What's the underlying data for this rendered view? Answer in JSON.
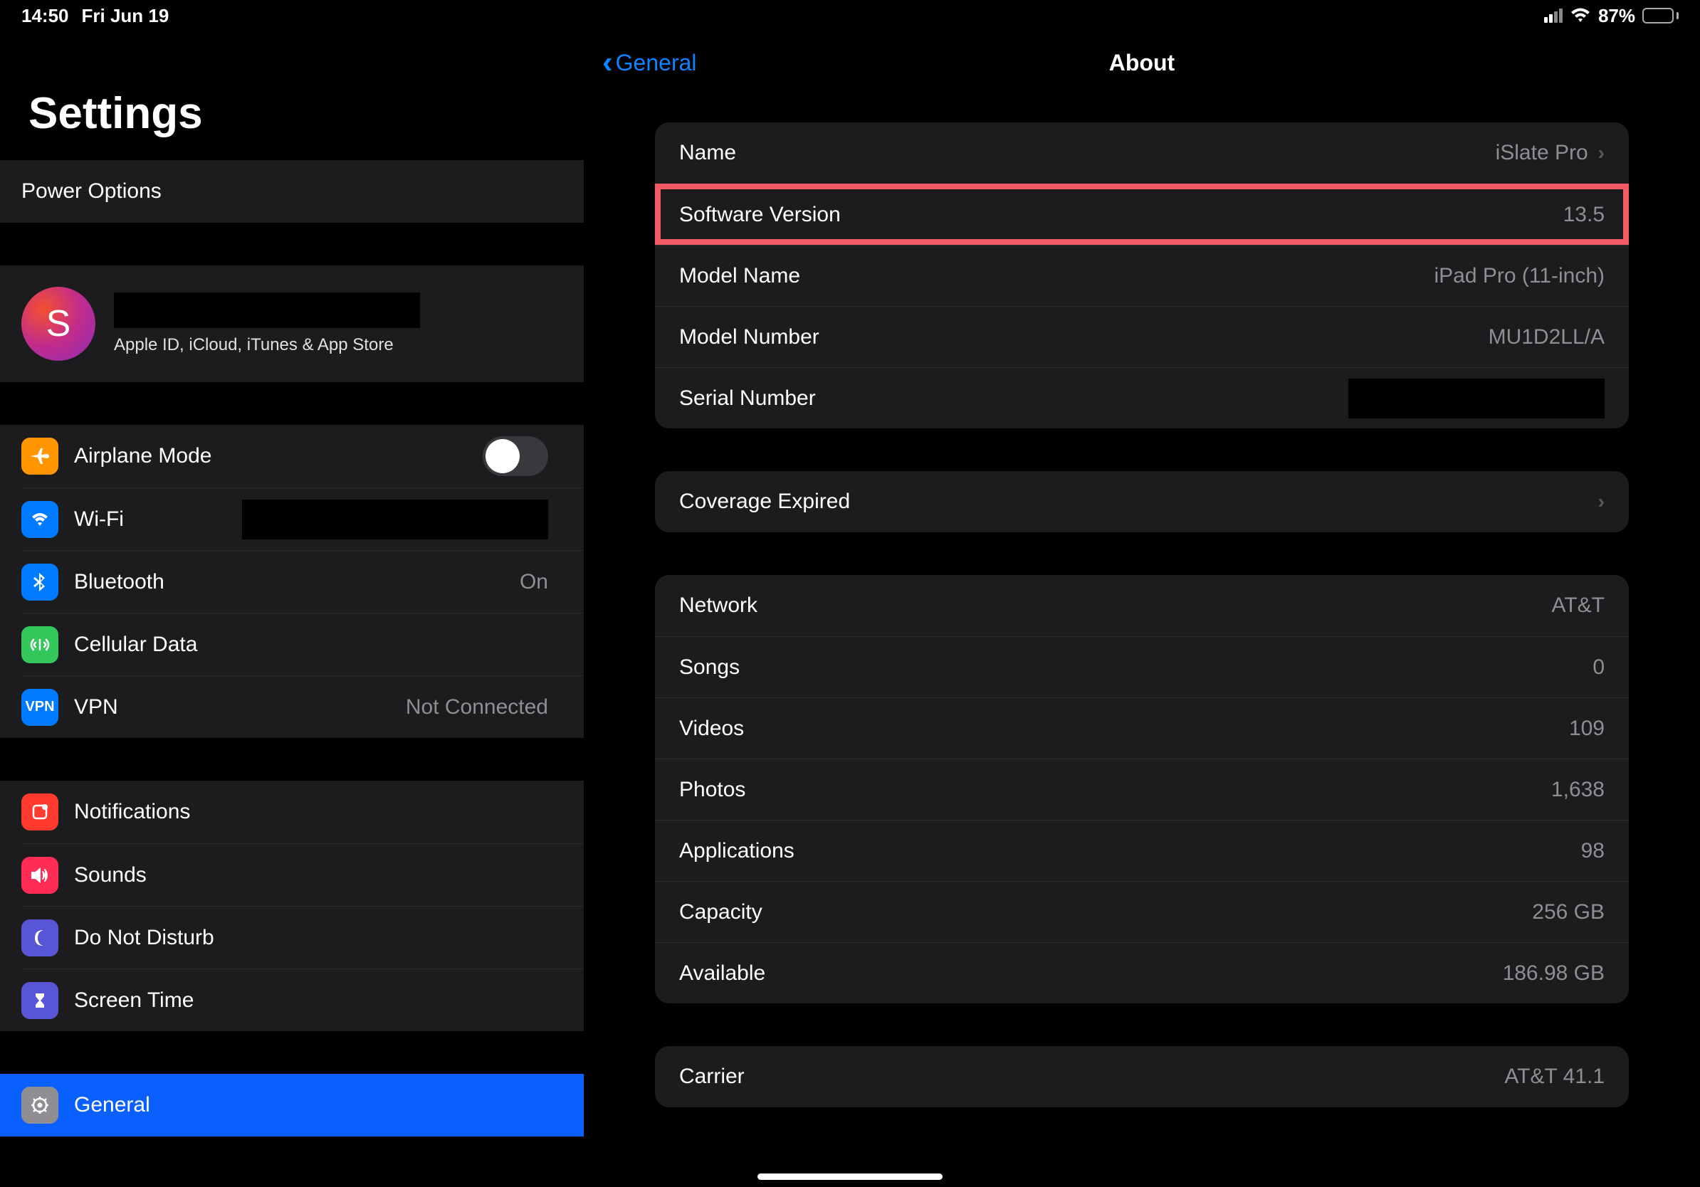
{
  "status": {
    "time": "14:50",
    "date": "Fri Jun 19",
    "battery_pct": "87%"
  },
  "sidebar": {
    "title": "Settings",
    "power_options": "Power Options",
    "account_sub": "Apple ID, iCloud, iTunes & App Store",
    "account_initial": "S",
    "items": {
      "airplane": "Airplane Mode",
      "wifi": "Wi-Fi",
      "bluetooth": "Bluetooth",
      "bluetooth_val": "On",
      "cellular": "Cellular Data",
      "vpn": "VPN",
      "vpn_val": "Not Connected",
      "notifications": "Notifications",
      "sounds": "Sounds",
      "dnd": "Do Not Disturb",
      "screentime": "Screen Time",
      "general": "General"
    }
  },
  "detail": {
    "back": "General",
    "title": "About",
    "g1": {
      "name_l": "Name",
      "name_v": "iSlate Pro",
      "sw_l": "Software Version",
      "sw_v": "13.5",
      "model_l": "Model Name",
      "model_v": "iPad Pro (11-inch)",
      "modelnum_l": "Model Number",
      "modelnum_v": "MU1D2LL/A",
      "serial_l": "Serial Number"
    },
    "g2": {
      "coverage_l": "Coverage Expired"
    },
    "g3": {
      "network_l": "Network",
      "network_v": "AT&T",
      "songs_l": "Songs",
      "songs_v": "0",
      "videos_l": "Videos",
      "videos_v": "109",
      "photos_l": "Photos",
      "photos_v": "1,638",
      "apps_l": "Applications",
      "apps_v": "98",
      "capacity_l": "Capacity",
      "capacity_v": "256 GB",
      "available_l": "Available",
      "available_v": "186.98 GB"
    },
    "g4": {
      "carrier_l": "Carrier",
      "carrier_v": "AT&T 41.1"
    }
  }
}
